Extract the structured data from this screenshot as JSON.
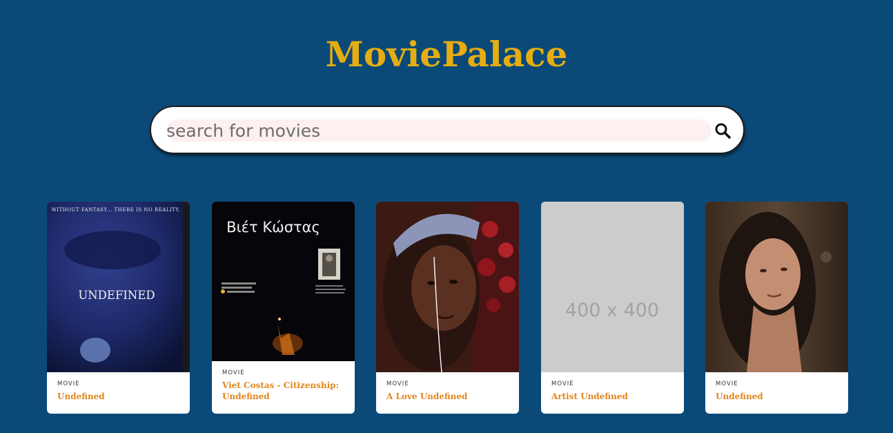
{
  "app": {
    "title": "MoviePalace"
  },
  "search": {
    "placeholder": "search for movies",
    "value": ""
  },
  "movies": [
    {
      "type": "MOVIE",
      "title": "Undefined",
      "poster_text": "UNDEFINED",
      "poster_top_text": "WITHOUT FANTASY... THERE IS NO REALITY."
    },
    {
      "type": "MOVIE",
      "title": "Viet Costas - Citizenship: Undefined",
      "poster_text": "Βιέτ Κώστας"
    },
    {
      "type": "MOVIE",
      "title": "A Love Undefined"
    },
    {
      "type": "MOVIE",
      "title": "Artist Undefined",
      "poster_text": "400 x 400"
    },
    {
      "type": "MOVIE",
      "title": "Undefined"
    }
  ],
  "colors": {
    "background": "#0b4a78",
    "title": "#e6ad12",
    "card_title": "#e0861e",
    "search_field": "#fdf0f0"
  },
  "icons": {
    "search_button": "search-icon"
  }
}
